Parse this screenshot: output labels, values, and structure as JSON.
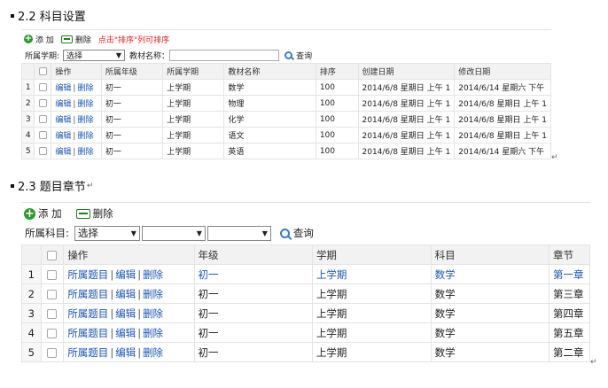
{
  "section1": {
    "heading": "2.2 科目设置",
    "toolbar": {
      "add": "添 加",
      "delete": "删除",
      "tip": "点击\"排序\"列可排序"
    },
    "filter": {
      "semester_label": "所属学期:",
      "semester_value": "选择",
      "textbook_label": "教材名称：",
      "textbook_value": "",
      "query": "查询"
    },
    "columns": [
      "",
      "",
      "操作",
      "所属年级",
      "所属学期",
      "教材名称",
      "排序",
      "创建日期",
      "修改日期"
    ],
    "rows": [
      {
        "no": "1",
        "op_edit": "编辑",
        "op_del": "删除",
        "grade": "初一",
        "semester": "上学期",
        "textbook": "数学",
        "sort": "100",
        "created": "2014/6/8 星期日 上午 1",
        "modified": "2014/6/14 星期六 下午"
      },
      {
        "no": "2",
        "op_edit": "编辑",
        "op_del": "删除",
        "grade": "初一",
        "semester": "上学期",
        "textbook": "物理",
        "sort": "100",
        "created": "2014/6/8 星期日 上午 1",
        "modified": "2014/6/8 星期日 上午 1"
      },
      {
        "no": "3",
        "op_edit": "编辑",
        "op_del": "删除",
        "grade": "初一",
        "semester": "上学期",
        "textbook": "化学",
        "sort": "100",
        "created": "2014/6/8 星期日 上午 1",
        "modified": "2014/6/8 星期日 上午 1"
      },
      {
        "no": "4",
        "op_edit": "编辑",
        "op_del": "删除",
        "grade": "初一",
        "semester": "上学期",
        "textbook": "语文",
        "sort": "100",
        "created": "2014/6/8 星期日 上午 1",
        "modified": "2014/6/8 星期日 上午 1"
      },
      {
        "no": "5",
        "op_edit": "编辑",
        "op_del": "删除",
        "grade": "初一",
        "semester": "上学期",
        "textbook": "英语",
        "sort": "100",
        "created": "2014/6/8 星期日 上午 1",
        "modified": "2014/6/14 星期六 下午"
      }
    ]
  },
  "section2": {
    "heading": "2.3 题目章节",
    "toolbar": {
      "add": "添 加",
      "delete": "删除"
    },
    "filter": {
      "subject_label": "所属科目:",
      "select1_value": "选择",
      "select2_value": "",
      "select3_value": "",
      "query": "查询"
    },
    "columns": [
      "",
      "",
      "操作",
      "年级",
      "学期",
      "科目",
      "章节"
    ],
    "rows": [
      {
        "no": "1",
        "op_questions": "所属题目",
        "op_edit": "编辑",
        "op_del": "删除",
        "grade": "初一",
        "semester": "上学期",
        "subject": "数学",
        "chapter": "第一章",
        "highlight": true
      },
      {
        "no": "2",
        "op_questions": "所属题目",
        "op_edit": "编辑",
        "op_del": "删除",
        "grade": "初一",
        "semester": "上学期",
        "subject": "数学",
        "chapter": "第三章",
        "highlight": false
      },
      {
        "no": "3",
        "op_questions": "所属题目",
        "op_edit": "编辑",
        "op_del": "删除",
        "grade": "初一",
        "semester": "上学期",
        "subject": "数学",
        "chapter": "第四章",
        "highlight": false
      },
      {
        "no": "4",
        "op_questions": "所属题目",
        "op_edit": "编辑",
        "op_del": "删除",
        "grade": "初一",
        "semester": "上学期",
        "subject": "数学",
        "chapter": "第五章",
        "highlight": false
      },
      {
        "no": "5",
        "op_questions": "所属题目",
        "op_edit": "编辑",
        "op_del": "删除",
        "grade": "初一",
        "semester": "上学期",
        "subject": "数学",
        "chapter": "第二章",
        "highlight": false
      }
    ]
  },
  "colors": {
    "link": "#1a56b8",
    "tip": "#e02020",
    "add_icon": "#2b9a2b",
    "delete_icon": "#1e7d1e",
    "search_icon": "#3c7fc4",
    "header_bg": "#f2f2f2"
  },
  "icons": {
    "add": "plus-circle-icon",
    "delete": "minus-box-icon",
    "query": "search-icon"
  }
}
